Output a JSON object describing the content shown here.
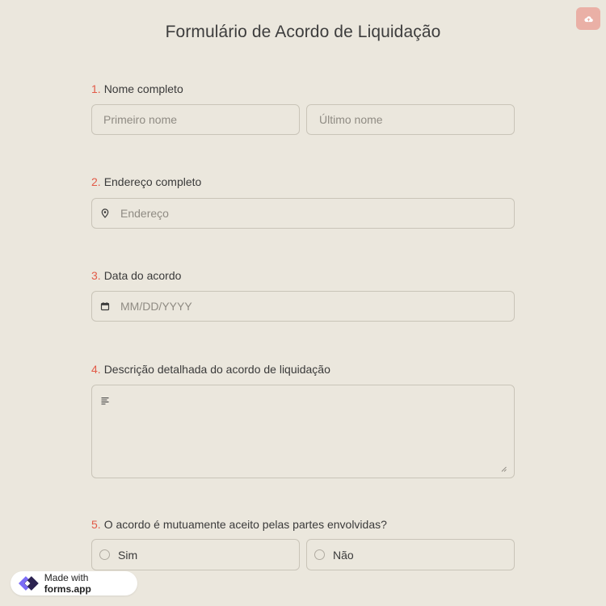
{
  "title": "Formulário de Acordo de Liquidação",
  "questions": [
    {
      "num": "1.",
      "label": "Nome completo",
      "first_placeholder": "Primeiro nome",
      "last_placeholder": "Último nome"
    },
    {
      "num": "2.",
      "label": "Endereço completo",
      "placeholder": "Endereço"
    },
    {
      "num": "3.",
      "label": "Data do acordo",
      "placeholder": "MM/DD/YYYY"
    },
    {
      "num": "4.",
      "label": "Descrição detalhada do acordo de liquidação"
    },
    {
      "num": "5.",
      "label": "O acordo é mutuamente aceito pelas partes envolvidas?",
      "options": [
        "Sim",
        "Não"
      ]
    }
  ],
  "badge": {
    "prefix": "Made with",
    "brand": "forms.app"
  },
  "icons": {
    "upload": "cloud-upload-icon",
    "address": "location-pin-icon",
    "date": "calendar-icon",
    "description": "text-lines-icon",
    "logo": "forms-app-logo-icon"
  },
  "colors": {
    "background": "#ebe7dd",
    "accent_number": "#e25a47",
    "upload_button": "#eab0a6",
    "border": "#c9c4b8"
  }
}
